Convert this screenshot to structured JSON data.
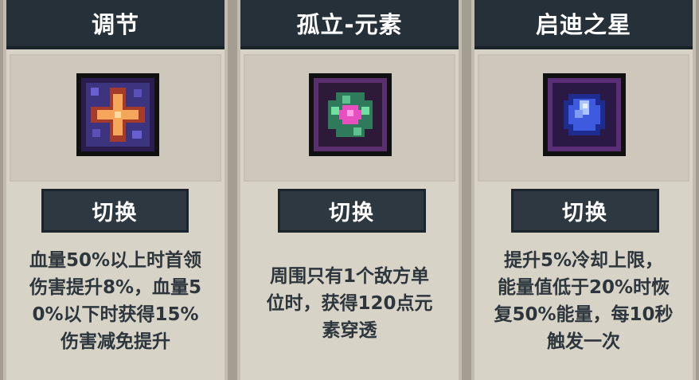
{
  "cards": [
    {
      "title": "调节",
      "icon": "plus-cross-icon",
      "accent": "#f5a65b",
      "button": "切换",
      "description": [
        "血量50%以上时首领",
        "伤害提升8%，血量5",
        "0%以下时获得15%",
        "伤害减免提升"
      ]
    },
    {
      "title": "孤立-元素",
      "icon": "element-gem-icon",
      "accent": "#e94fc0",
      "button": "切换",
      "description": [
        "周围只有1个敌方单",
        "位时，获得120点元",
        "素穿透"
      ]
    },
    {
      "title": "启迪之星",
      "icon": "blue-star-gem-icon",
      "accent": "#3e5be0",
      "button": "切换",
      "description": [
        "提升5%冷却上限，",
        "能量值低于20%时恢",
        "复50%能量，每10秒",
        "触发一次"
      ]
    }
  ]
}
